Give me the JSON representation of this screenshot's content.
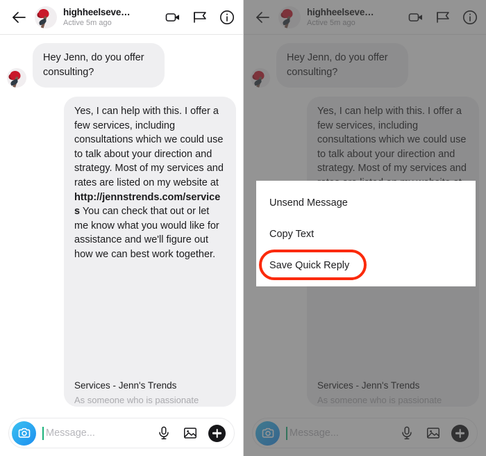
{
  "app": "instagram-direct-message",
  "colors": {
    "bubble": "#efeff1",
    "highlight": "#fb2a0b",
    "camera_blue": "#1e8ff0",
    "caret_green": "#1ab27a",
    "text": "#1b1b1d"
  },
  "header": {
    "back_icon": "back-arrow-icon",
    "avatar_icon": "profile-avatar",
    "username": "highheelseve…",
    "active_status": "Active 5m ago",
    "icons": [
      {
        "name": "video-call-icon",
        "label": "Video call"
      },
      {
        "name": "flag-icon",
        "label": "Flag"
      },
      {
        "name": "info-icon",
        "label": "Info"
      }
    ]
  },
  "thread": {
    "messages": [
      {
        "direction": "incoming",
        "avatar_icon": "sender-avatar",
        "text": "Hey Jenn, do you offer consulting?"
      },
      {
        "direction": "outgoing",
        "text_before_link": "Yes, I can help with this. I offer a few services, including consultations which we could use to talk about your direction and strategy. Most of my services and rates are listed on my website at ",
        "link_text": "http://jennstrends.com/services",
        "text_after_link": " You can check that out or let me know what you would like for assistance and we'll figure out how we can best work together.",
        "preview": {
          "title": "Services - Jenn's Trends",
          "description": "As someone who is passionate"
        }
      }
    ]
  },
  "composer": {
    "camera_icon": "camera-icon",
    "placeholder": "Message...",
    "value": "",
    "icons": [
      {
        "name": "microphone-icon",
        "label": "Voice message"
      },
      {
        "name": "photo-icon",
        "label": "Photo"
      },
      {
        "name": "plus-icon",
        "label": "More options"
      }
    ]
  },
  "context_menu": {
    "items": [
      {
        "label": "Unsend Message",
        "highlighted": false
      },
      {
        "label": "Copy Text",
        "highlighted": false
      },
      {
        "label": "Save Quick Reply",
        "highlighted": true
      }
    ]
  }
}
